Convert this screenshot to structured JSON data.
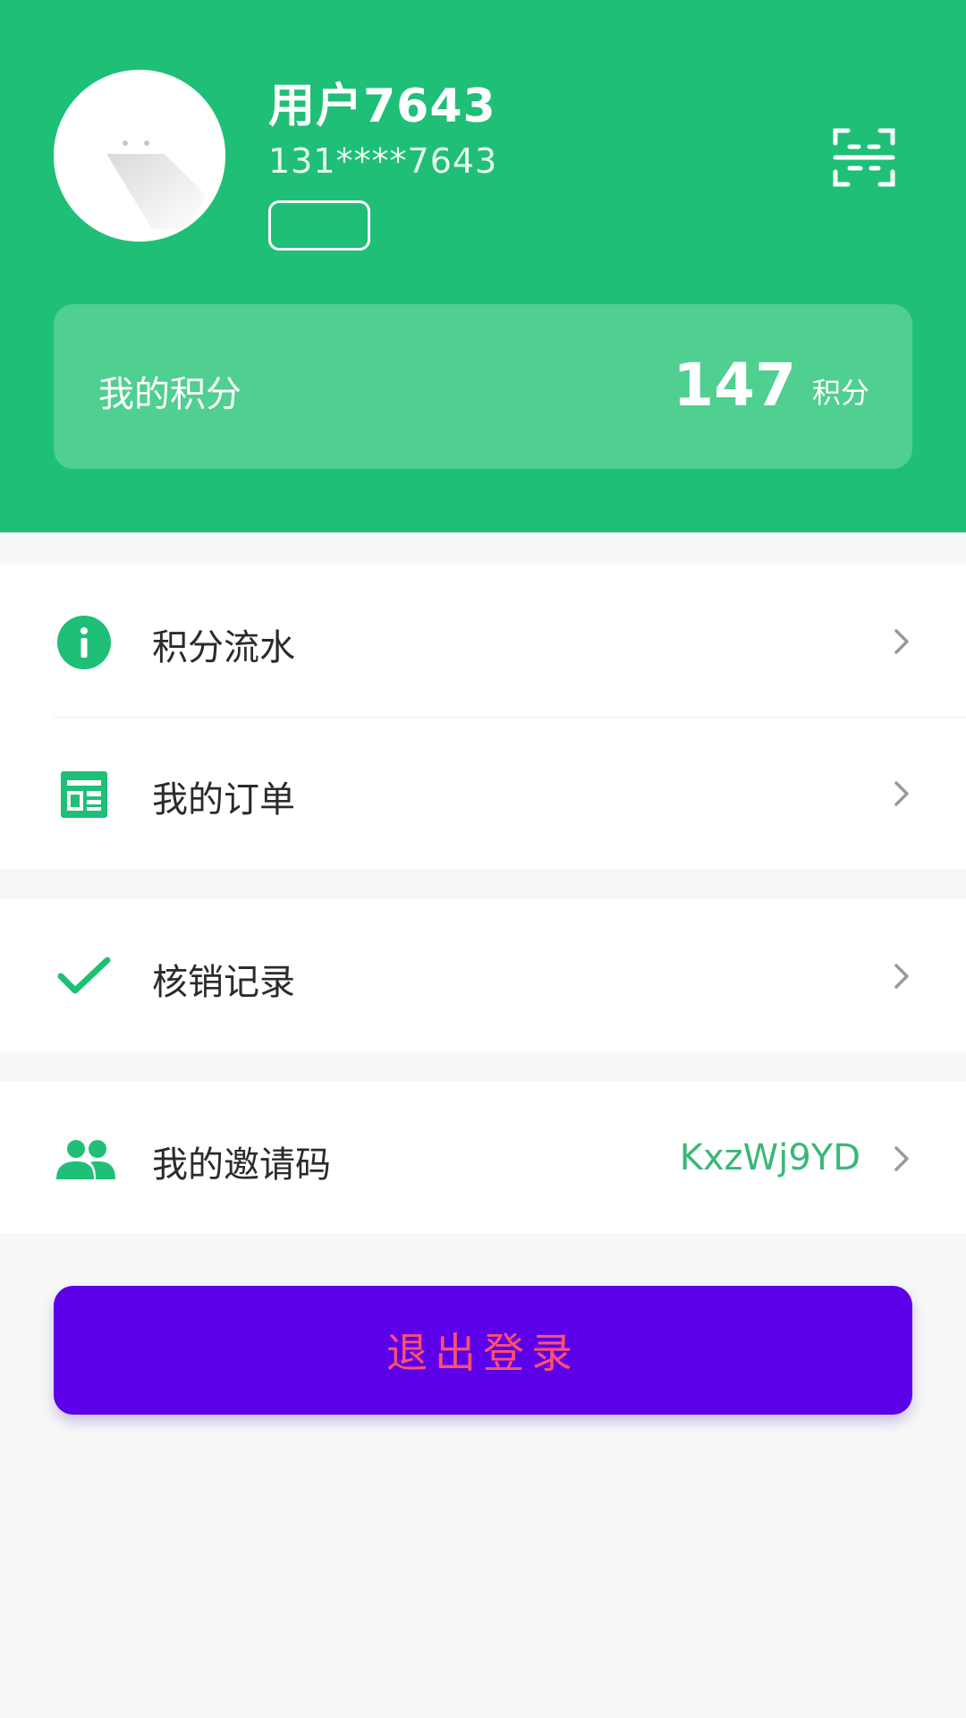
{
  "profile": {
    "username": "用户7643",
    "phone": "131****7643"
  },
  "points": {
    "label": "我的积分",
    "value": "147",
    "unit": "积分"
  },
  "menu": {
    "points_history": "积分流水",
    "orders": "我的订单",
    "verify_records": "核销记录",
    "invite_code_label": "我的邀请码",
    "invite_code_value": "KxzWj9YD"
  },
  "logout_label": "退出登录",
  "colors": {
    "primary_green": "#1fbf77",
    "card_green": "#4fcf90",
    "logout_bg": "#5b00e8",
    "logout_text": "#ff4f6f",
    "invite_code_text": "#3ab879"
  },
  "icons": {
    "avatar": "default-avatar-icon",
    "scan": "scan-icon",
    "points_history": "info-icon",
    "orders": "document-list-icon",
    "verify_records": "checkmark-icon",
    "invite_code": "people-icon",
    "row_arrow": "chevron-right-icon"
  }
}
